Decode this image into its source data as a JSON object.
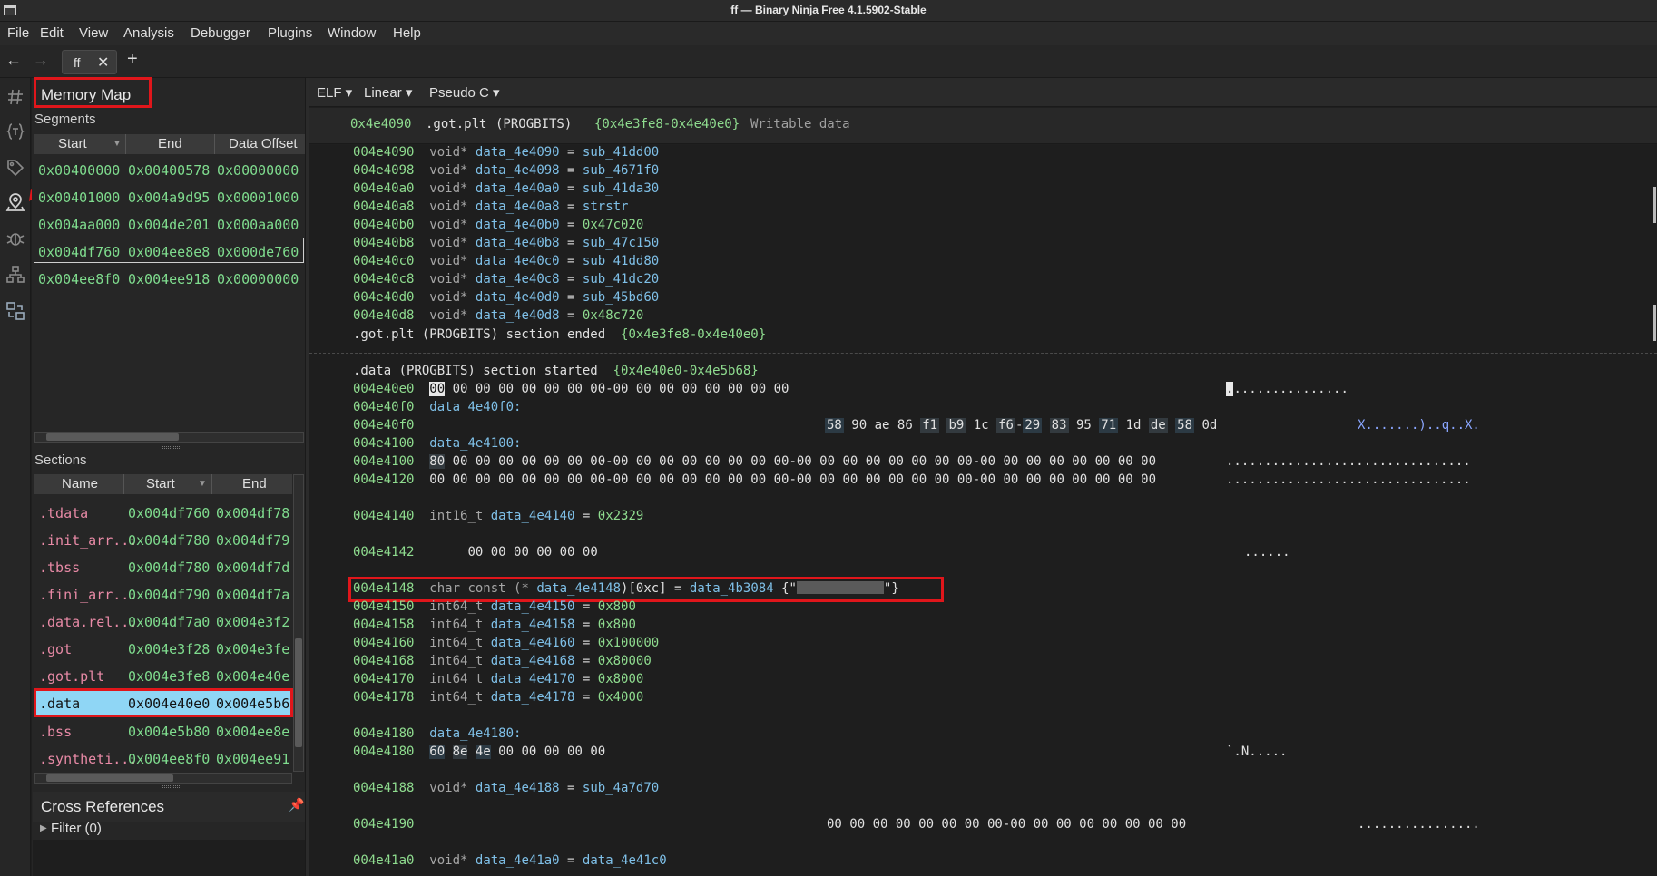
{
  "window": {
    "title": "ff — Binary Ninja Free 4.1.5902-Stable"
  },
  "menu": [
    "File",
    "Edit",
    "View",
    "Analysis",
    "Debugger",
    "Plugins",
    "Window",
    "Help"
  ],
  "tabs": [
    {
      "label": "ff"
    }
  ],
  "nav": {
    "back": "←",
    "forward": "→",
    "close": "✕",
    "add": "+"
  },
  "memory_map": {
    "title": "Memory Map",
    "segments_label": "Segments",
    "segment_columns": [
      "Start",
      "End",
      "Data Offset"
    ],
    "segments": [
      [
        "0x00400000",
        "0x00400578",
        "0x00000000"
      ],
      [
        "0x00401000",
        "0x004a9d95",
        "0x00001000"
      ],
      [
        "0x004aa000",
        "0x004de201",
        "0x000aa000"
      ],
      [
        "0x004df760",
        "0x004ee8e8",
        "0x000de760"
      ],
      [
        "0x004ee8f0",
        "0x004ee918",
        "0x00000000"
      ]
    ],
    "sections_label": "Sections",
    "section_columns": [
      "Name",
      "Start",
      "End"
    ],
    "sections": [
      [
        ".tdata",
        "0x004df760",
        "0x004df78"
      ],
      [
        ".init_arr...",
        "0x004df780",
        "0x004df79"
      ],
      [
        ".tbss",
        "0x004df780",
        "0x004df7d"
      ],
      [
        ".fini_arr...",
        "0x004df790",
        "0x004df7a"
      ],
      [
        ".data.rel...",
        "0x004df7a0",
        "0x004e3f2"
      ],
      [
        ".got",
        "0x004e3f28",
        "0x004e3fe"
      ],
      [
        ".got.plt",
        "0x004e3fe8",
        "0x004e40e"
      ],
      [
        ".data",
        "0x004e40e0",
        "0x004e5b6"
      ],
      [
        ".bss",
        "0x004e5b80",
        "0x004ee8e"
      ],
      [
        ".syntheti...",
        "0x004ee8f0",
        "0x004ee91"
      ]
    ]
  },
  "cross_references": {
    "title": "Cross References",
    "filter": "Filter (0)"
  },
  "view_header": {
    "elf": "ELF ▾",
    "linear": "Linear ▾",
    "pseudo": "Pseudo C ▾"
  },
  "section_header": {
    "addr": "0x4e4090",
    "name": ".got.plt",
    "kind": "(PROGBITS)",
    "range": "{0x4e3fe8-0x4e40e0}",
    "desc": "Writable data"
  },
  "got_entries": [
    [
      "004e4090",
      "void*",
      "data_4e4090",
      "sub_41dd00"
    ],
    [
      "004e4098",
      "void*",
      "data_4e4098",
      "sub_4671f0"
    ],
    [
      "004e40a0",
      "void*",
      "data_4e40a0",
      "sub_41da30"
    ],
    [
      "004e40a8",
      "void*",
      "data_4e40a8",
      "strstr"
    ],
    [
      "004e40b0",
      "void*",
      "data_4e40b0",
      "0x47c020"
    ],
    [
      "004e40b8",
      "void*",
      "data_4e40b8",
      "sub_47c150"
    ],
    [
      "004e40c0",
      "void*",
      "data_4e40c0",
      "sub_41dd80"
    ],
    [
      "004e40c8",
      "void*",
      "data_4e40c8",
      "sub_41dc20"
    ],
    [
      "004e40d0",
      "void*",
      "data_4e40d0",
      "sub_45bd60"
    ],
    [
      "004e40d8",
      "void*",
      "data_4e40d8",
      "0x48c720"
    ]
  ],
  "got_end": {
    "text": ".got.plt (PROGBITS) section ended",
    "range": "{0x4e3fe8-0x4e40e0}"
  },
  "data_start": {
    "text": ".data (PROGBITS) section started",
    "range": "{0x4e40e0-0x4e5b68}"
  },
  "lines": {
    "l1_addr": "004e40e0",
    "l1_first": "00",
    "l1_hex": " 00 00 00 00 00 00 00-00 00 00 00 00 00 00 00",
    "l1_ascii_first": ".",
    "l1_ascii": "...............",
    "l2_addr": "004e40f0",
    "l2_label": "data_4e40f0:",
    "l3_addr": "004e40f0",
    "l3_bytes": [
      "58",
      "90",
      "ae",
      "86",
      "f1",
      "b9",
      "1c",
      "f6",
      "29",
      "83",
      "95",
      "71",
      "1d",
      "de",
      "58",
      "0d"
    ],
    "l3_ascii": "X.......)..q..X.",
    "l4_addr": "004e4100",
    "l4_label": "data_4e4100:",
    "l5_addr": "004e4100",
    "l5_first": "80",
    "l5_hex": " 00 00 00 00 00 00 00-00 00 00 00 00 00 00 00-00 00 00 00 00 00 00 00-00 00 00 00 00 00 00 00",
    "l5_ascii": "................................",
    "l6_addr": "004e4120",
    "l6_hex": "00 00 00 00 00 00 00 00-00 00 00 00 00 00 00 00-00 00 00 00 00 00 00 00-00 00 00 00 00 00 00 00",
    "l6_ascii": "................................",
    "l7_addr": "004e4140",
    "l7_type": "int16_t",
    "l7_name": "data_4e4140",
    "l7_val": "0x2329",
    "l8_addr": "004e4142",
    "l8_hex": "00 00 00 00 00 00",
    "l8_ascii": "......",
    "l9_addr": "004e4148",
    "l9_type": "char const (*",
    "l9_name": "data_4e4148",
    "l9_rest": ")[0xc] =",
    "l9_ref": "data_4b3084",
    "l9_str_open": "{\"",
    "l9_str_close": "\"}",
    "l10_addr": "004e4188",
    "l10_type": "void*",
    "l10_name": "data_4e4188",
    "l10_val": "sub_4a7d70",
    "l11_addr": "004e4190",
    "l11_hex": "00 00 00 00 00 00 00 00-00 00 00 00 00 00 00 00",
    "l11_ascii": "................",
    "l12_addr": "004e41a0",
    "l12_type": "void*",
    "l12_name": "data_4e41a0",
    "l12_val": "data_4e41c0",
    "l13_addr": "004e4180",
    "l13_label": "data_4e4180:",
    "l14_addr": "004e4180",
    "l14_b1": "60",
    "l14_b2": "8e",
    "l14_b3": "4e",
    "l14_hex": " 00 00 00 00 00",
    "l14_ascii": "`.N....."
  },
  "int64_entries": [
    [
      "004e4150",
      "int64_t",
      "data_4e4150",
      "0x800"
    ],
    [
      "004e4158",
      "int64_t",
      "data_4e4158",
      "0x800"
    ],
    [
      "004e4160",
      "int64_t",
      "data_4e4160",
      "0x100000"
    ],
    [
      "004e4168",
      "int64_t",
      "data_4e4168",
      "0x80000"
    ],
    [
      "004e4170",
      "int64_t",
      "data_4e4170",
      "0x8000"
    ],
    [
      "004e4178",
      "int64_t",
      "data_4e4178",
      "0x4000"
    ]
  ]
}
